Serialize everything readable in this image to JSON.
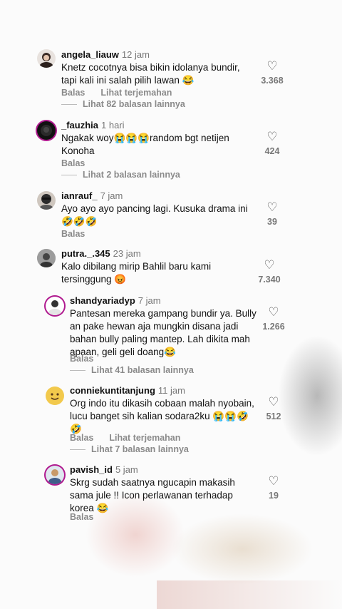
{
  "comments": [
    {
      "username": "angela_liauw",
      "time": "12 jam",
      "text": "Knetz cocotnya bisa bikin idolanya bundir, tapi kali ini salah pilih lawan 😂",
      "likes": "3.368",
      "reply": "Balas",
      "translate": "Lihat terjemahan",
      "view_replies": "Lihat 82 balasan lainnya"
    },
    {
      "username": "_fauzhia",
      "time": "1 hari",
      "text": "Ngakak woy😭😭😭random bgt netijen Konoha",
      "likes": "424",
      "reply": "Balas",
      "view_replies": "Lihat 2 balasan lainnya"
    },
    {
      "username": "ianrauf_",
      "time": "7 jam",
      "text": "Ayo ayo ayo pancing lagi. Kusuka drama ini 🤣🤣🤣",
      "likes": "39",
      "reply": "Balas"
    },
    {
      "username": "putra._.345",
      "time": "23 jam",
      "text": "Kalo dibilang mirip Bahlil baru kami tersinggung 😡",
      "likes": "7.340"
    },
    {
      "username": "shandyariadyp",
      "time": "7 jam",
      "text": "Pantesan mereka gampang bundir ya. Bully an pake hewan aja mungkin disana jadi bahan bully paling mantep. Lah dikita mah apaan, geli geli doang😂",
      "likes": "1.266",
      "reply": "Balas",
      "view_replies": "Lihat 41 balasan lainnya"
    },
    {
      "username": "conniekuntitanjung",
      "time": "11 jam",
      "text": "Org indo itu dikasih cobaan malah nyobain, lucu banget sih kalian sodara2ku 😭😭🤣🤣",
      "likes": "512",
      "reply": "Balas",
      "translate": "Lihat terjemahan",
      "view_replies": "Lihat 7 balasan lainnya"
    },
    {
      "username": "pavish_id",
      "time": "5 jam",
      "text": "Skrg sudah saatnya ngucapin makasih sama jule !! Icon perlawanan terhadap korea 😂",
      "likes": "19",
      "reply": "Balas"
    }
  ]
}
